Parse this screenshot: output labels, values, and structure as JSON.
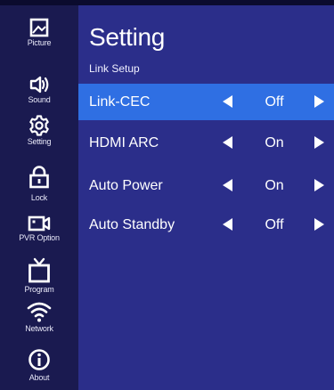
{
  "sidebar": {
    "items": [
      {
        "label": "Picture",
        "icon": "picture-icon"
      },
      {
        "label": "Sound",
        "icon": "speaker-icon"
      },
      {
        "label": "Setting",
        "icon": "gear-icon"
      },
      {
        "label": "Lock",
        "icon": "lock-icon"
      },
      {
        "label": "PVR Option",
        "icon": "video-camera-icon"
      },
      {
        "label": "Program",
        "icon": "tv-icon"
      },
      {
        "label": "Network",
        "icon": "wifi-icon"
      },
      {
        "label": "About",
        "icon": "info-icon"
      }
    ]
  },
  "main": {
    "title": "Setting",
    "subtitle": "Link Setup",
    "rows": [
      {
        "label": "Link-CEC",
        "value": "Off"
      },
      {
        "label": "HDMI ARC",
        "value": "On"
      },
      {
        "label": "Auto Power",
        "value": "On"
      },
      {
        "label": "Auto Standby",
        "value": "Off"
      }
    ]
  },
  "colors": {
    "sidebar_bg": "#1a1a50",
    "main_bg": "#2b2e8a",
    "selected_row": "#2f6fe3",
    "text": "#ffffff"
  }
}
